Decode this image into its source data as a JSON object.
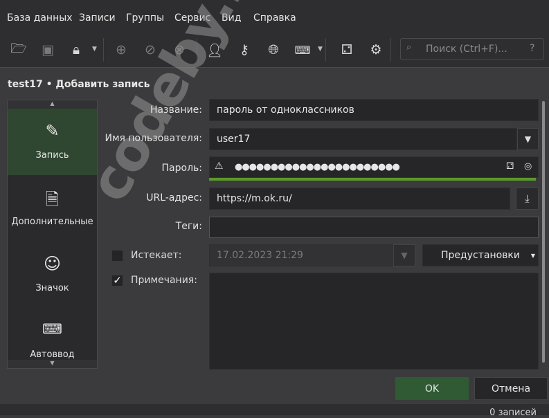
{
  "menu": [
    "База данных",
    "Записи",
    "Группы",
    "Сервис",
    "Вид",
    "Справка"
  ],
  "toolbar": {
    "icons": [
      "open-database",
      "save-database",
      "lock-database",
      "add-entry",
      "edit-entry",
      "delete-entry",
      "copy-username",
      "copy-password",
      "copy-url",
      "autotype",
      "password-generator",
      "settings"
    ],
    "search_placeholder": "Поиск (Ctrl+F)...",
    "search_help": "?"
  },
  "dialog": {
    "title": "test17 • Добавить запись",
    "sidebar": [
      "Запись",
      "Дополнительные",
      "Значок",
      "Автоввод"
    ],
    "fields": {
      "title_label": "Название:",
      "title_value": "пароль от одноклассников",
      "username_label": "Имя пользователя:",
      "username_value": "user17",
      "password_label": "Пароль:",
      "password_value": "●●●●●●●●●●●●●●●●●●●●●●●",
      "password_strength": 1.0,
      "url_label": "URL-адрес:",
      "url_value": "https://m.ok.ru/",
      "tags_label": "Теги:",
      "tags_value": "",
      "expires_label": "Истекает:",
      "expires_checked": false,
      "expires_value": "17.02.2023 21:29",
      "presets_label": "Предустановки",
      "notes_label": "Примечания:",
      "notes_checked": true,
      "notes_value": ""
    },
    "ok_label": "OK",
    "cancel_label": "Отмена"
  },
  "status": "0 записей",
  "watermark": "codeby.net",
  "colors": {
    "accent": "#2f5a33",
    "strength": "#5a9a2a"
  }
}
